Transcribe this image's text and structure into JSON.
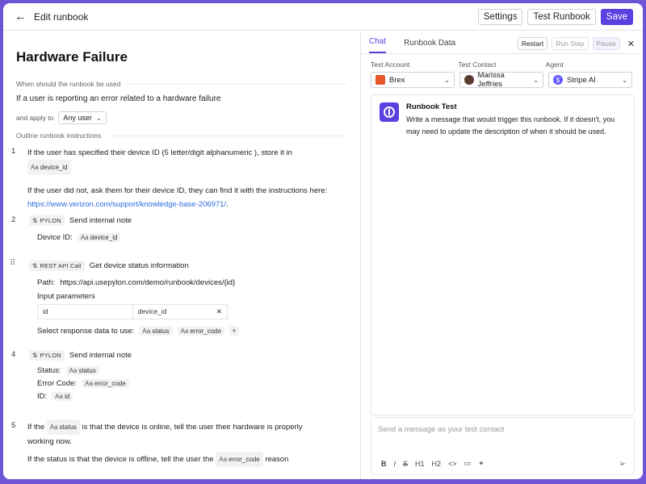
{
  "topbar": {
    "title": "Edit runbook",
    "settings": "Settings",
    "test_runbook": "Test Runbook",
    "save": "Save"
  },
  "runbook": {
    "title": "Hardware Failure",
    "when_label": "When should the runbook be used",
    "condition": "If a user is reporting an error related to a hardware failure",
    "apply_to_label": "and apply to",
    "apply_to_value": "Any user",
    "outline_label": "Outline runbook instructions"
  },
  "steps": {
    "s1": {
      "num": "1",
      "text_a": "If the user has specified their device ID (5 letter/digit alphanumeric ), store it in",
      "var": "device_id",
      "text_b": "If the user did not, ask them for their device ID, they can find it with the instructions here:",
      "link": "https://www.verizon.com/support/knowledge-base-206971/",
      "link_suffix": "."
    },
    "s2": {
      "num": "2",
      "badge": "PYLON",
      "action": "Send internal note",
      "field_label": "Device ID:",
      "var": "device_id"
    },
    "s3": {
      "badge": "REST API Call",
      "action": "Get device status information",
      "path_label": "Path:",
      "path": "https://api.usepylon.com/demo/runbook/devices/{id}",
      "input_label": "Input parameters",
      "param_key": "id",
      "param_val": "device_id",
      "response_label": "Select response data to use:",
      "var1": "status",
      "var2": "error_code"
    },
    "s4": {
      "num": "4",
      "badge": "PYLON",
      "action": "Send internal note",
      "status_label": "Status:",
      "status_var": "status",
      "error_label": "Error Code:",
      "error_var": "error_code",
      "id_label": "ID:",
      "id_var": "id"
    },
    "s5": {
      "num": "5",
      "text_a": "If the",
      "var": "status",
      "text_b": "is that the device is online, tell the user their hardware is properly",
      "text_c": "working now.",
      "text_d": "If the status is that the device is offline, tell the user the",
      "var2": "error_code",
      "text_e": "reason"
    }
  },
  "panel": {
    "tabs": [
      "Chat",
      "Runbook Data"
    ],
    "restart": "Restart",
    "run_step": "Run Step",
    "pause": "Pause",
    "labels": {
      "account": "Test Account",
      "contact": "Test Contact",
      "agent": "Agent"
    },
    "account": "Brex",
    "contact": "Marissa Jeffries",
    "agent": "Stripe AI",
    "message_title": "Runbook Test",
    "message_text": "Write a message that would trigger this runbook. If it doesn't, you may need to update the description of when it should be used.",
    "composer_placeholder": "Send a message as your test contact",
    "format": [
      "B",
      "I",
      "S",
      "H1",
      "H2"
    ]
  },
  "colors": {
    "accent": "#5b3fe0",
    "link": "#2d6cdf",
    "brex": "#e8572a",
    "stripe": "#635bff"
  }
}
